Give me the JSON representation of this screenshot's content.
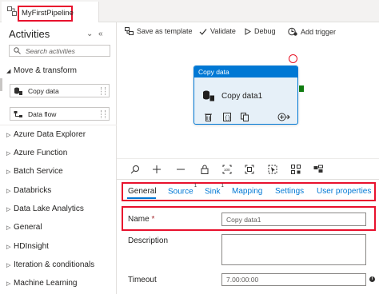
{
  "tab": {
    "title": "MyFirstPipeline"
  },
  "activities": {
    "title": "Activities",
    "collapse_glyph": "⌄",
    "hide_glyph": "«",
    "search_placeholder": "Search activities",
    "move_transform": "Move & transform",
    "items": [
      {
        "label": "Copy data",
        "icon": "copy-data-icon"
      },
      {
        "label": "Data flow",
        "icon": "data-flow-icon"
      }
    ],
    "categories": [
      "Azure Data Explorer",
      "Azure Function",
      "Batch Service",
      "Databricks",
      "Data Lake Analytics",
      "General",
      "HDInsight",
      "Iteration & conditionals",
      "Machine Learning"
    ]
  },
  "toolbar": {
    "save_as_template": "Save as template",
    "validate": "Validate",
    "debug": "Debug",
    "add_trigger": "Add trigger"
  },
  "node": {
    "header": "Copy data",
    "name": "Copy data1"
  },
  "properties": {
    "tabs": [
      {
        "label": "General",
        "badge": ""
      },
      {
        "label": "Source",
        "badge": "1"
      },
      {
        "label": "Sink",
        "badge": "1"
      },
      {
        "label": "Mapping",
        "badge": ""
      },
      {
        "label": "Settings",
        "badge": ""
      },
      {
        "label": "User properties",
        "badge": ""
      }
    ],
    "name_label": "Name",
    "required_mark": "*",
    "name_value": "Copy data1",
    "description_label": "Description",
    "description_value": "",
    "timeout_label": "Timeout",
    "timeout_value": "7.00:00:00"
  },
  "colors": {
    "accent": "#0078d4",
    "highlight_border": "#e8112d",
    "handle_success": "#107c10"
  }
}
